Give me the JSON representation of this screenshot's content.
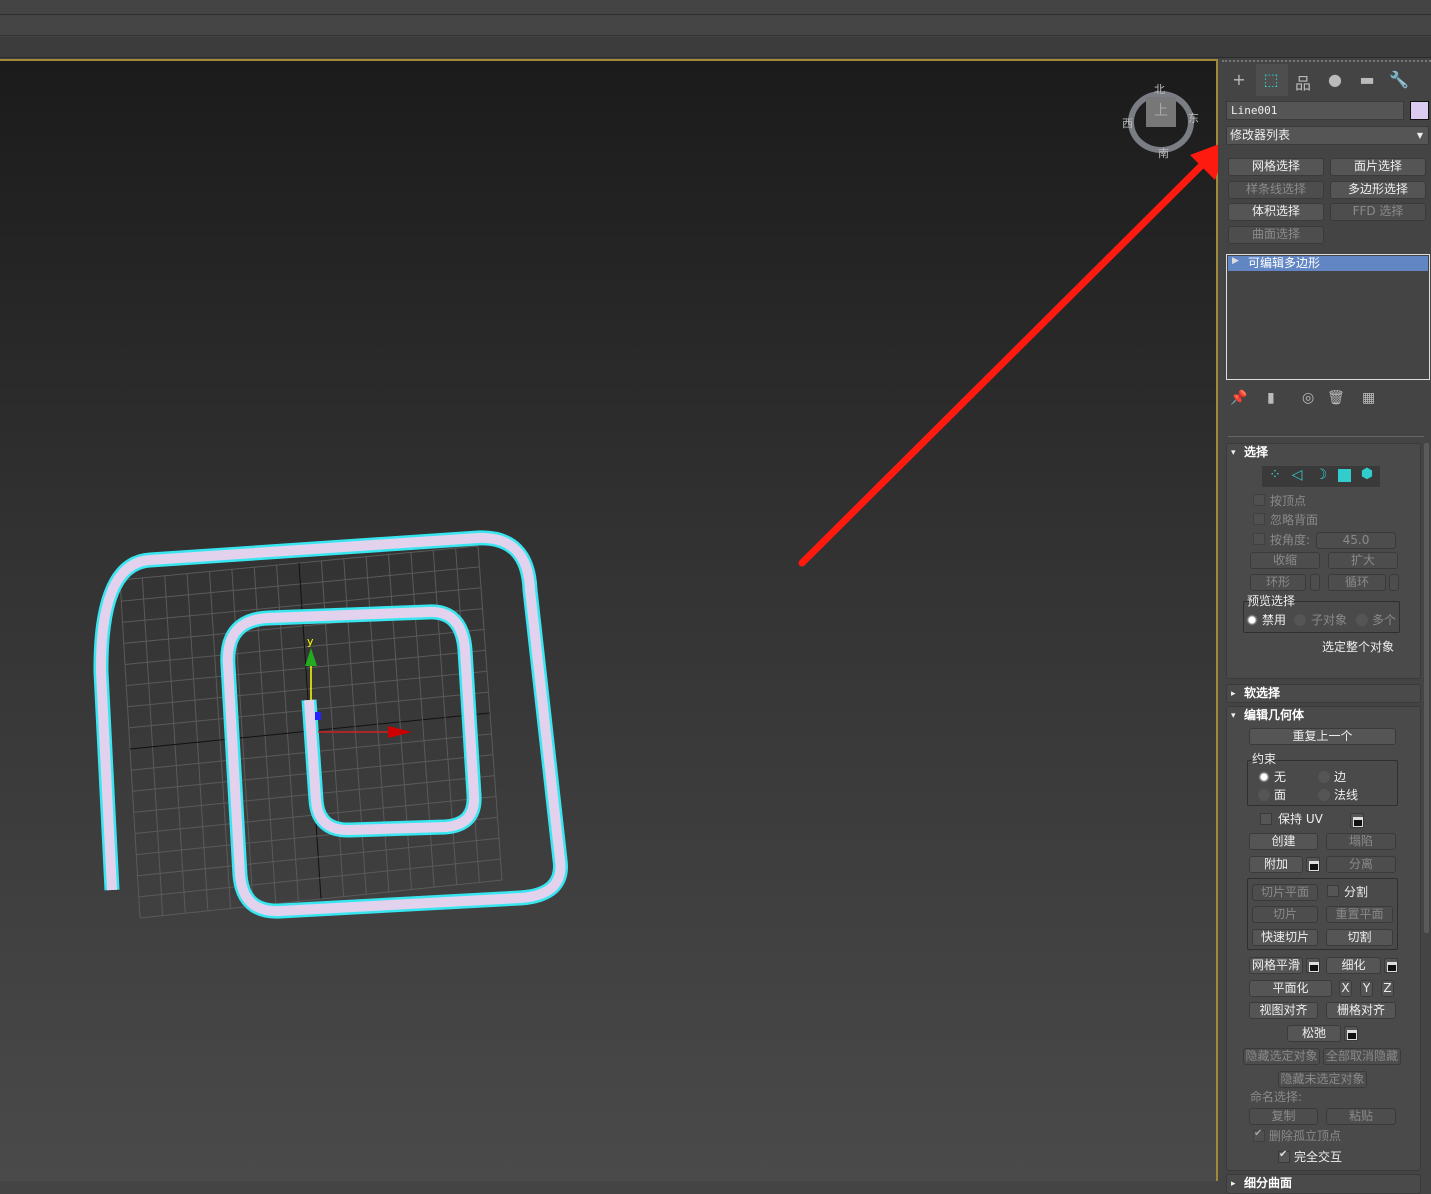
{
  "viewport": {
    "compass": {
      "north": "北",
      "south": "南",
      "east": "东",
      "west": "西",
      "cube_face": "上"
    },
    "axis_label_y": "y",
    "colors": {
      "selection_outline": "#38e6f0",
      "object_fill": "#e2d2ee",
      "arrow": "#ff1a10",
      "frame": "#a08a3a"
    }
  },
  "panel": {
    "tabs": [
      {
        "icon": "create-icon",
        "glyph": "+"
      },
      {
        "icon": "modify-icon",
        "glyph": "⬚"
      },
      {
        "icon": "hierarchy-icon",
        "glyph": "品"
      },
      {
        "icon": "motion-icon",
        "glyph": "●"
      },
      {
        "icon": "display-icon",
        "glyph": "▬"
      },
      {
        "icon": "utilities-icon",
        "glyph": "🔧"
      }
    ],
    "object_name": "Line001",
    "object_color": "#dccbf0",
    "modifier_list": "修改器列表",
    "modifier_buttons": [
      {
        "label": "网格选择",
        "enabled": true
      },
      {
        "label": "面片选择",
        "enabled": true
      },
      {
        "label": "样条线选择",
        "enabled": false
      },
      {
        "label": "多边形选择",
        "enabled": true
      },
      {
        "label": "体积选择",
        "enabled": true
      },
      {
        "label": "FFD 选择",
        "enabled": false
      },
      {
        "label": "曲面选择",
        "enabled": false
      }
    ],
    "stack_item": "可编辑多边形",
    "selection": {
      "title": "选择",
      "by_vertex": "按顶点",
      "ignore_backfacing": "忽略背面",
      "by_angle": "按角度:",
      "angle_value": "45.0",
      "shrink": "收缩",
      "grow": "扩大",
      "ring": "环形",
      "loop": "循环",
      "preview_title": "预览选择",
      "preview_off": "禁用",
      "preview_subobject": "子对象",
      "preview_multi": "多个",
      "whole_object": "选定整个对象"
    },
    "soft_selection": {
      "title": "软选择"
    },
    "edit_geometry": {
      "title": "编辑几何体",
      "repeat_last": "重复上一个",
      "constraints_title": "约束",
      "c_none": "无",
      "c_edge": "边",
      "c_face": "面",
      "c_normal": "法线",
      "preserve_uv": "保持 UV",
      "create": "创建",
      "collapse": "塌陷",
      "attach": "附加",
      "detach": "分离",
      "slice_plane": "切片平面",
      "split": "分割",
      "slice": "切片",
      "reset_plane": "重置平面",
      "quickslice": "快速切片",
      "cut": "切割",
      "meshsmooth": "网格平滑",
      "tessellate": "细化",
      "make_planar": "平面化",
      "x": "X",
      "y": "Y",
      "z": "Z",
      "view_align": "视图对齐",
      "grid_align": "栅格对齐",
      "relax": "松弛",
      "hide_selected": "隐藏选定对象",
      "unhide_all": "全部取消隐藏",
      "hide_unselected": "隐藏未选定对象",
      "named_selections": "命名选择:",
      "copy": "复制",
      "paste": "粘贴",
      "delete_isolated": "删除孤立顶点",
      "full_interactivity": "完全交互"
    },
    "subdivision": {
      "title": "细分曲面"
    }
  }
}
